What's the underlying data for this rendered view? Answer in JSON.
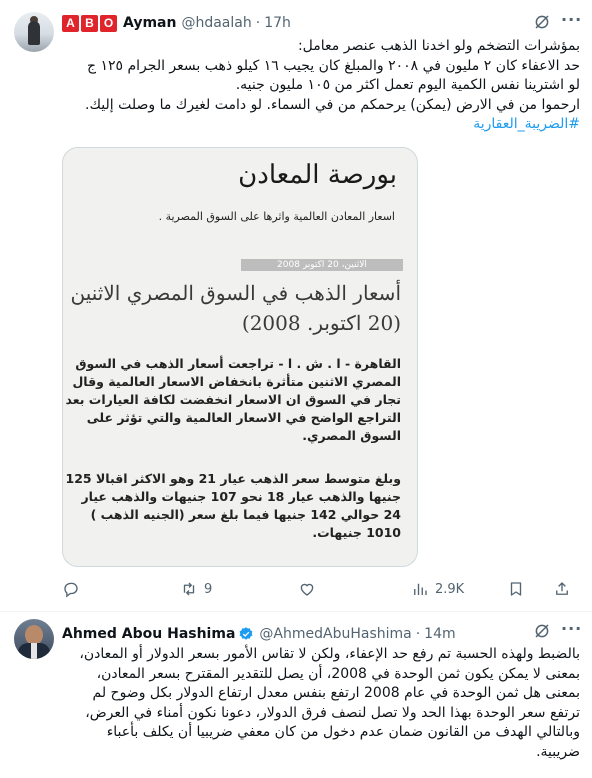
{
  "tweet1": {
    "badge_letters": [
      "A",
      "B",
      "O"
    ],
    "author_name": "Ayman",
    "handle": "@hdaalah",
    "separator": "·",
    "time": "17h",
    "lines": [
      "بمؤشرات التضخم ولو اخدنا الذهب عنصر معامل:",
      "حد الاعفاء كان ٢ مليون في ٢٠٠٨ والمبلغ كان يجيب ١٦ كيلو ذهب بسعر الجرام ١٢٥ ج",
      "لو اشترينا نفس الكمية اليوم تعمل اكثر من ١٠٥ مليون جنيه.",
      "ارحموا من في الارض (يمكن) يرحمكم من في السماء. لو دامت لغيرك ما وصلت إليك."
    ],
    "hashtag": "#الضريبة_العقارية",
    "media": {
      "masthead": "بورصة المعادن",
      "subtitle": "اسعار المعادن العالمية واثرها على السوق المصرية .",
      "date_bar": "الاثنين، 20 اكتوبر 2008",
      "headline_lines": [
        "أسعار الذهب في السوق المصري الاثنين",
        "(20 اكتوبر. 2008)"
      ],
      "paragraph1_lines": [
        "القاهرة - ا . ش . ا - تراجعت أسعار الذهب في السوق",
        "المصري الاثنين متأثرة بانخفاض الاسعار العالمية وقال",
        "تجار في السوق ان الاسعار انخفضت لكافة العيارات بعد",
        "التراجع الواضح في الاسعار العالمية والتي تؤثر على",
        "السوق المصري."
      ],
      "paragraph2_lines": [
        "وبلغ متوسط سعر الذهب عيار 21 وهو الاكثر اقبالا 125",
        "جنيها والذهب عيار 18 نحو 107 جنيهات والذهب عيار",
        "24 حوالي 142 جنيها فيما بلغ سعر (الجنيه الذهب )",
        "1010 جنيهات."
      ]
    },
    "actions": {
      "reply": "",
      "retweet": "9",
      "like": "",
      "views": "2.9K"
    }
  },
  "tweet2": {
    "author_name": "Ahmed Abou Hashima",
    "handle": "@AhmedAbuHashima",
    "separator": "·",
    "time": "14m",
    "lines": [
      "بالضبط ولهذه الحسبة تم رفع حد الإعفاء، ولكن لا تقاس الأمور بسعر الدولار أو المعادن،",
      "بمعنى لا يمكن يكون ثمن الوحدة في 2008، أن يصل للتقدير المقترح بسعر المعادن،",
      "بمعنى هل ثمن الوحدة في عام 2008 ارتفع بنفس معدل ارتفاع الدولار بكل وضوح لم",
      "ترتفع سعر الوحدة بهذا الحد ولا تصل لنصف فرق الدولار، دعونا نكون أمناء في العرض،",
      "وبالتالي الهدف من القانون ضمان عدم دخول من كان معفي ضريبيا أن يكلف بأعباء",
      "ضريبية."
    ]
  },
  "colors": {
    "accent": "#1d9bf0",
    "muted": "#536471",
    "text": "#0f1419",
    "badge": "#e0242b"
  }
}
